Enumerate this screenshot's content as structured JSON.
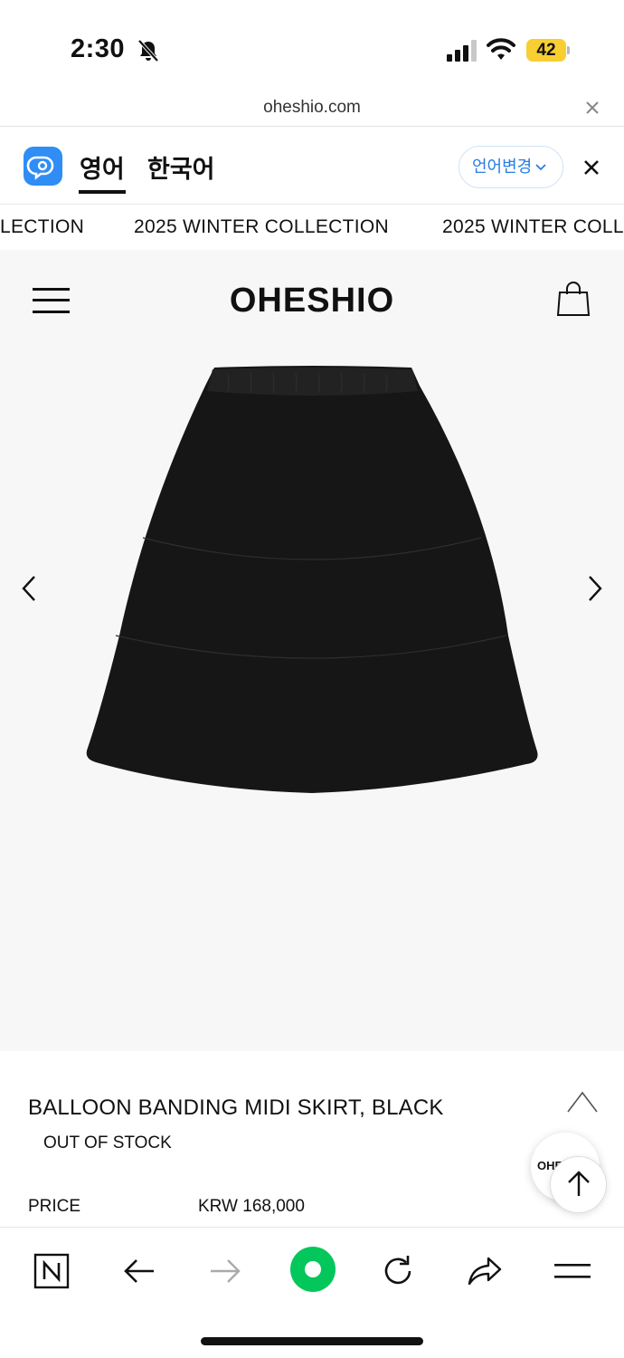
{
  "status_bar": {
    "time": "2:30",
    "battery": "42"
  },
  "url_bar": {
    "url": "oheshio.com"
  },
  "translate_bar": {
    "lang_en": "영어",
    "lang_ko": "한국어",
    "change_lang": "언어변경"
  },
  "marquee": {
    "text": "2025 WINTER COLLECTION",
    "left_fragment": "LECTION",
    "right_fragment": "2025 WINTER COLL"
  },
  "site": {
    "logo": "OHESHIO"
  },
  "product": {
    "title": "BALLOON BANDING MIDI SKIRT, BLACK",
    "stock": "OUT OF STOCK",
    "price_label": "PRICE",
    "price_value": "KRW 168,000",
    "chat_label": "OHESHIO"
  },
  "colors": {
    "accent_blue": "#2a7de1",
    "papago_blue": "#2f8df5",
    "naver_green": "#03c75a",
    "battery_yellow": "#f7cf32"
  }
}
